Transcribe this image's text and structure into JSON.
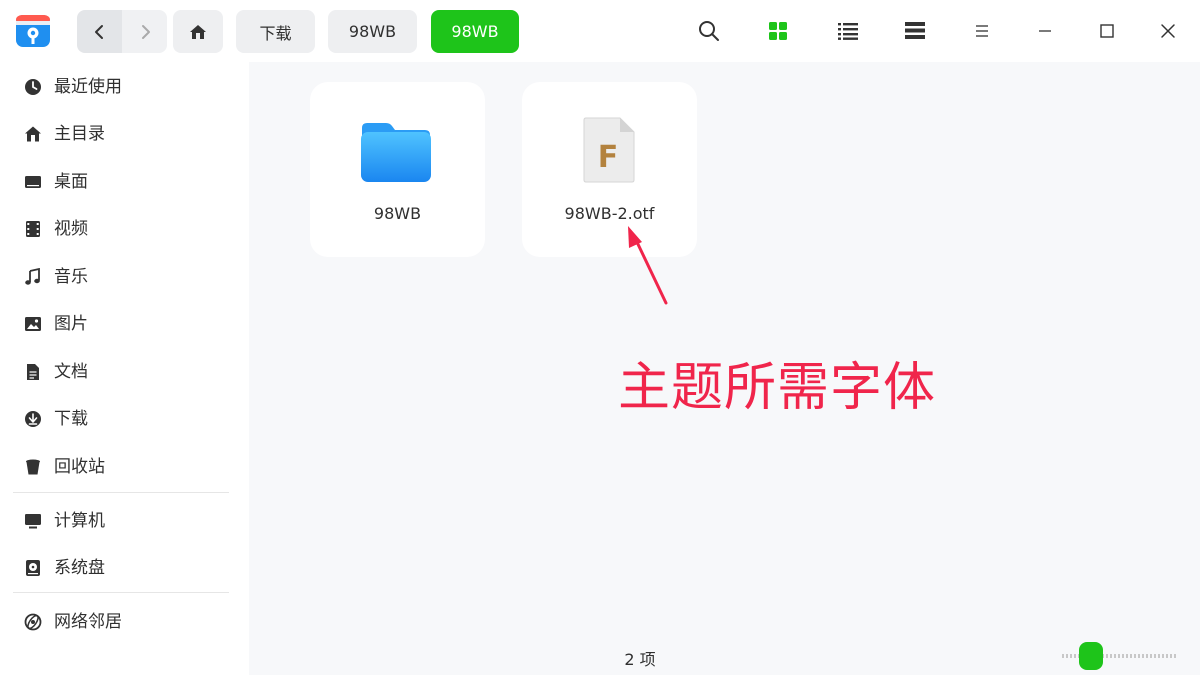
{
  "titlebar": {
    "breadcrumbs": [
      "下载",
      "98WB",
      "98WB"
    ],
    "active_crumb_index": 2,
    "icons": [
      "app-logo-icon",
      "chevron-left-icon",
      "chevron-right-icon",
      "home-icon",
      "search-icon",
      "grid-view-icon",
      "list-view-icon",
      "tree-view-icon",
      "menu-icon",
      "minimize-icon",
      "maximize-icon",
      "close-icon"
    ],
    "accent_color": "#1ec41a"
  },
  "sidebar": {
    "items": [
      {
        "label": "最近使用",
        "icon": "clock-icon"
      },
      {
        "label": "主目录",
        "icon": "home-icon"
      },
      {
        "label": "桌面",
        "icon": "desktop-icon"
      },
      {
        "label": "视频",
        "icon": "film-icon"
      },
      {
        "label": "音乐",
        "icon": "music-note-icon"
      },
      {
        "label": "图片",
        "icon": "image-icon"
      },
      {
        "label": "文档",
        "icon": "document-icon"
      },
      {
        "label": "下载",
        "icon": "download-icon"
      },
      {
        "label": "回收站",
        "icon": "trash-icon"
      },
      {
        "label": "计算机",
        "icon": "computer-icon"
      },
      {
        "label": "系统盘",
        "icon": "disk-icon"
      },
      {
        "label": "网络邻居",
        "icon": "network-icon"
      }
    ]
  },
  "files": [
    {
      "name": "98WB",
      "icon": "folder-icon"
    },
    {
      "name": "98WB-2.otf",
      "icon": "font-file-icon"
    }
  ],
  "annotation": {
    "text": "主题所需字体",
    "color": "#f0254b"
  },
  "statusbar": {
    "item_count": "2 项"
  }
}
